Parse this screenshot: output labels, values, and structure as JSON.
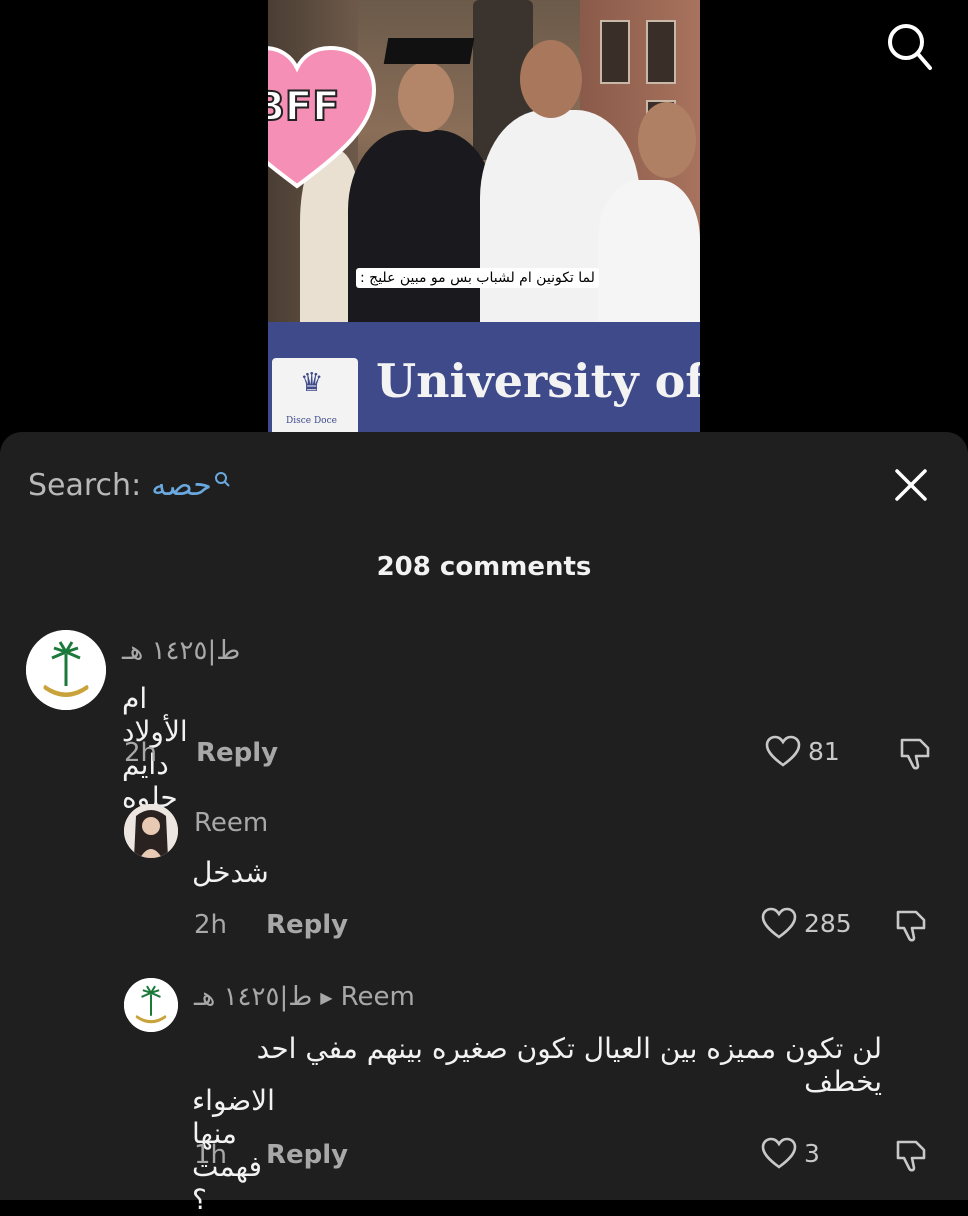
{
  "video": {
    "caption": "لما تكونين ام لشباب بس مو مبين عليج :",
    "sticker_text": "BFF",
    "banner_text": "University of",
    "crest_text": "Disce Doce"
  },
  "sheet": {
    "search_label": "Search:",
    "search_term": "حصه",
    "comment_count": "208 comments"
  },
  "comments": [
    {
      "username": "ط|١٤٢٥ هـ",
      "text": "ام الأولاد دايم حلوه",
      "time": "2h",
      "reply_label": "Reply",
      "likes": "81"
    },
    {
      "username": "Reem",
      "text": "شدخل",
      "time": "2h",
      "reply_label": "Reply",
      "likes": "285"
    },
    {
      "username": "ط|١٤٢٥ هـ",
      "reply_to": "Reem",
      "text_line1": "لن تكون مميزه بين العيال تكون صغيره بينهم مفي احد يخطف",
      "text_line2": "الاضواء منها فهمت ؟",
      "time": "1h",
      "reply_label": "Reply",
      "likes": "3"
    }
  ],
  "colors": {
    "sheet_bg": "#1f1f1f",
    "accent_search_term": "#6aa9e0",
    "muted_text": "#a8a8a8"
  }
}
